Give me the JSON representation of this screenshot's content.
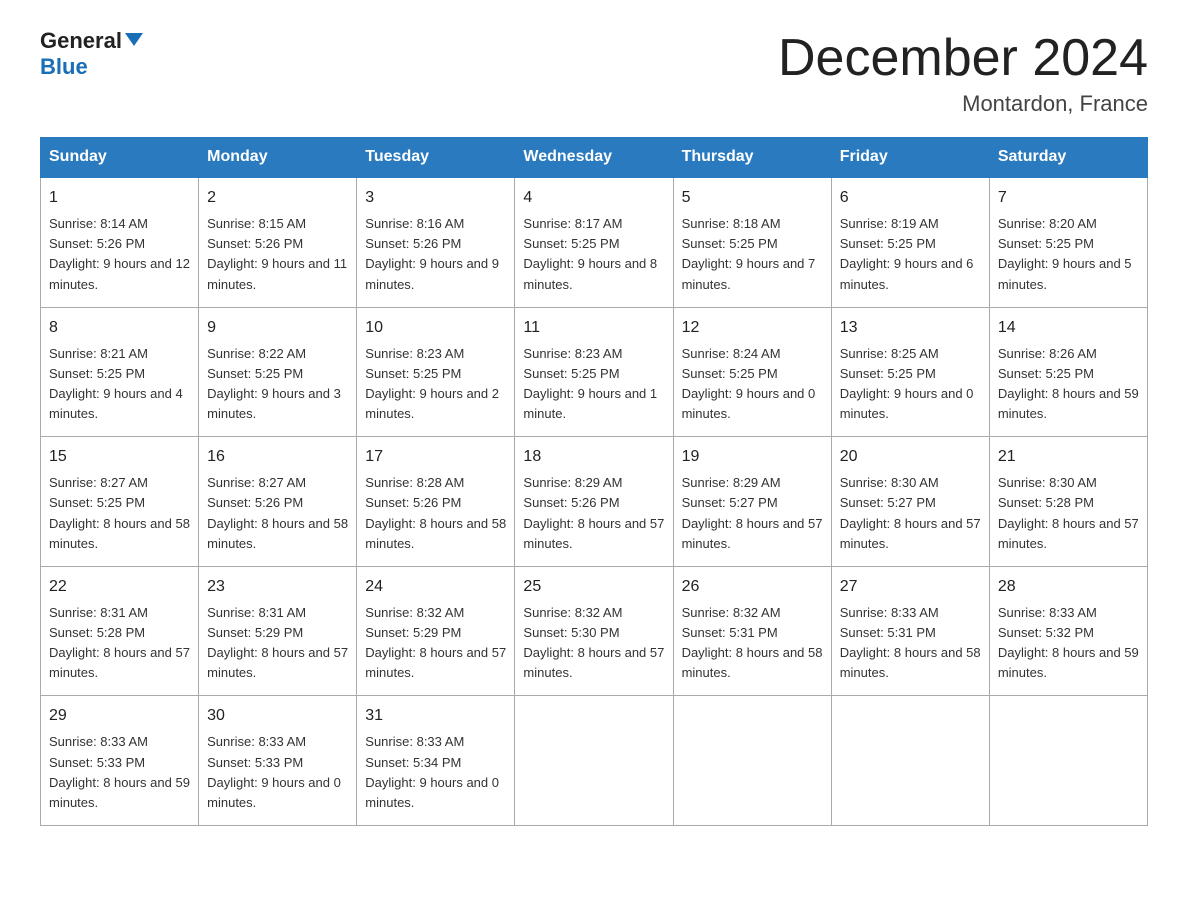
{
  "header": {
    "logo_general": "General",
    "logo_blue": "Blue",
    "month_title": "December 2024",
    "location": "Montardon, France"
  },
  "days_of_week": [
    "Sunday",
    "Monday",
    "Tuesday",
    "Wednesday",
    "Thursday",
    "Friday",
    "Saturday"
  ],
  "weeks": [
    [
      {
        "day": "1",
        "sunrise": "Sunrise: 8:14 AM",
        "sunset": "Sunset: 5:26 PM",
        "daylight": "Daylight: 9 hours and 12 minutes."
      },
      {
        "day": "2",
        "sunrise": "Sunrise: 8:15 AM",
        "sunset": "Sunset: 5:26 PM",
        "daylight": "Daylight: 9 hours and 11 minutes."
      },
      {
        "day": "3",
        "sunrise": "Sunrise: 8:16 AM",
        "sunset": "Sunset: 5:26 PM",
        "daylight": "Daylight: 9 hours and 9 minutes."
      },
      {
        "day": "4",
        "sunrise": "Sunrise: 8:17 AM",
        "sunset": "Sunset: 5:25 PM",
        "daylight": "Daylight: 9 hours and 8 minutes."
      },
      {
        "day": "5",
        "sunrise": "Sunrise: 8:18 AM",
        "sunset": "Sunset: 5:25 PM",
        "daylight": "Daylight: 9 hours and 7 minutes."
      },
      {
        "day": "6",
        "sunrise": "Sunrise: 8:19 AM",
        "sunset": "Sunset: 5:25 PM",
        "daylight": "Daylight: 9 hours and 6 minutes."
      },
      {
        "day": "7",
        "sunrise": "Sunrise: 8:20 AM",
        "sunset": "Sunset: 5:25 PM",
        "daylight": "Daylight: 9 hours and 5 minutes."
      }
    ],
    [
      {
        "day": "8",
        "sunrise": "Sunrise: 8:21 AM",
        "sunset": "Sunset: 5:25 PM",
        "daylight": "Daylight: 9 hours and 4 minutes."
      },
      {
        "day": "9",
        "sunrise": "Sunrise: 8:22 AM",
        "sunset": "Sunset: 5:25 PM",
        "daylight": "Daylight: 9 hours and 3 minutes."
      },
      {
        "day": "10",
        "sunrise": "Sunrise: 8:23 AM",
        "sunset": "Sunset: 5:25 PM",
        "daylight": "Daylight: 9 hours and 2 minutes."
      },
      {
        "day": "11",
        "sunrise": "Sunrise: 8:23 AM",
        "sunset": "Sunset: 5:25 PM",
        "daylight": "Daylight: 9 hours and 1 minute."
      },
      {
        "day": "12",
        "sunrise": "Sunrise: 8:24 AM",
        "sunset": "Sunset: 5:25 PM",
        "daylight": "Daylight: 9 hours and 0 minutes."
      },
      {
        "day": "13",
        "sunrise": "Sunrise: 8:25 AM",
        "sunset": "Sunset: 5:25 PM",
        "daylight": "Daylight: 9 hours and 0 minutes."
      },
      {
        "day": "14",
        "sunrise": "Sunrise: 8:26 AM",
        "sunset": "Sunset: 5:25 PM",
        "daylight": "Daylight: 8 hours and 59 minutes."
      }
    ],
    [
      {
        "day": "15",
        "sunrise": "Sunrise: 8:27 AM",
        "sunset": "Sunset: 5:25 PM",
        "daylight": "Daylight: 8 hours and 58 minutes."
      },
      {
        "day": "16",
        "sunrise": "Sunrise: 8:27 AM",
        "sunset": "Sunset: 5:26 PM",
        "daylight": "Daylight: 8 hours and 58 minutes."
      },
      {
        "day": "17",
        "sunrise": "Sunrise: 8:28 AM",
        "sunset": "Sunset: 5:26 PM",
        "daylight": "Daylight: 8 hours and 58 minutes."
      },
      {
        "day": "18",
        "sunrise": "Sunrise: 8:29 AM",
        "sunset": "Sunset: 5:26 PM",
        "daylight": "Daylight: 8 hours and 57 minutes."
      },
      {
        "day": "19",
        "sunrise": "Sunrise: 8:29 AM",
        "sunset": "Sunset: 5:27 PM",
        "daylight": "Daylight: 8 hours and 57 minutes."
      },
      {
        "day": "20",
        "sunrise": "Sunrise: 8:30 AM",
        "sunset": "Sunset: 5:27 PM",
        "daylight": "Daylight: 8 hours and 57 minutes."
      },
      {
        "day": "21",
        "sunrise": "Sunrise: 8:30 AM",
        "sunset": "Sunset: 5:28 PM",
        "daylight": "Daylight: 8 hours and 57 minutes."
      }
    ],
    [
      {
        "day": "22",
        "sunrise": "Sunrise: 8:31 AM",
        "sunset": "Sunset: 5:28 PM",
        "daylight": "Daylight: 8 hours and 57 minutes."
      },
      {
        "day": "23",
        "sunrise": "Sunrise: 8:31 AM",
        "sunset": "Sunset: 5:29 PM",
        "daylight": "Daylight: 8 hours and 57 minutes."
      },
      {
        "day": "24",
        "sunrise": "Sunrise: 8:32 AM",
        "sunset": "Sunset: 5:29 PM",
        "daylight": "Daylight: 8 hours and 57 minutes."
      },
      {
        "day": "25",
        "sunrise": "Sunrise: 8:32 AM",
        "sunset": "Sunset: 5:30 PM",
        "daylight": "Daylight: 8 hours and 57 minutes."
      },
      {
        "day": "26",
        "sunrise": "Sunrise: 8:32 AM",
        "sunset": "Sunset: 5:31 PM",
        "daylight": "Daylight: 8 hours and 58 minutes."
      },
      {
        "day": "27",
        "sunrise": "Sunrise: 8:33 AM",
        "sunset": "Sunset: 5:31 PM",
        "daylight": "Daylight: 8 hours and 58 minutes."
      },
      {
        "day": "28",
        "sunrise": "Sunrise: 8:33 AM",
        "sunset": "Sunset: 5:32 PM",
        "daylight": "Daylight: 8 hours and 59 minutes."
      }
    ],
    [
      {
        "day": "29",
        "sunrise": "Sunrise: 8:33 AM",
        "sunset": "Sunset: 5:33 PM",
        "daylight": "Daylight: 8 hours and 59 minutes."
      },
      {
        "day": "30",
        "sunrise": "Sunrise: 8:33 AM",
        "sunset": "Sunset: 5:33 PM",
        "daylight": "Daylight: 9 hours and 0 minutes."
      },
      {
        "day": "31",
        "sunrise": "Sunrise: 8:33 AM",
        "sunset": "Sunset: 5:34 PM",
        "daylight": "Daylight: 9 hours and 0 minutes."
      },
      {
        "day": "",
        "sunrise": "",
        "sunset": "",
        "daylight": ""
      },
      {
        "day": "",
        "sunrise": "",
        "sunset": "",
        "daylight": ""
      },
      {
        "day": "",
        "sunrise": "",
        "sunset": "",
        "daylight": ""
      },
      {
        "day": "",
        "sunrise": "",
        "sunset": "",
        "daylight": ""
      }
    ]
  ]
}
